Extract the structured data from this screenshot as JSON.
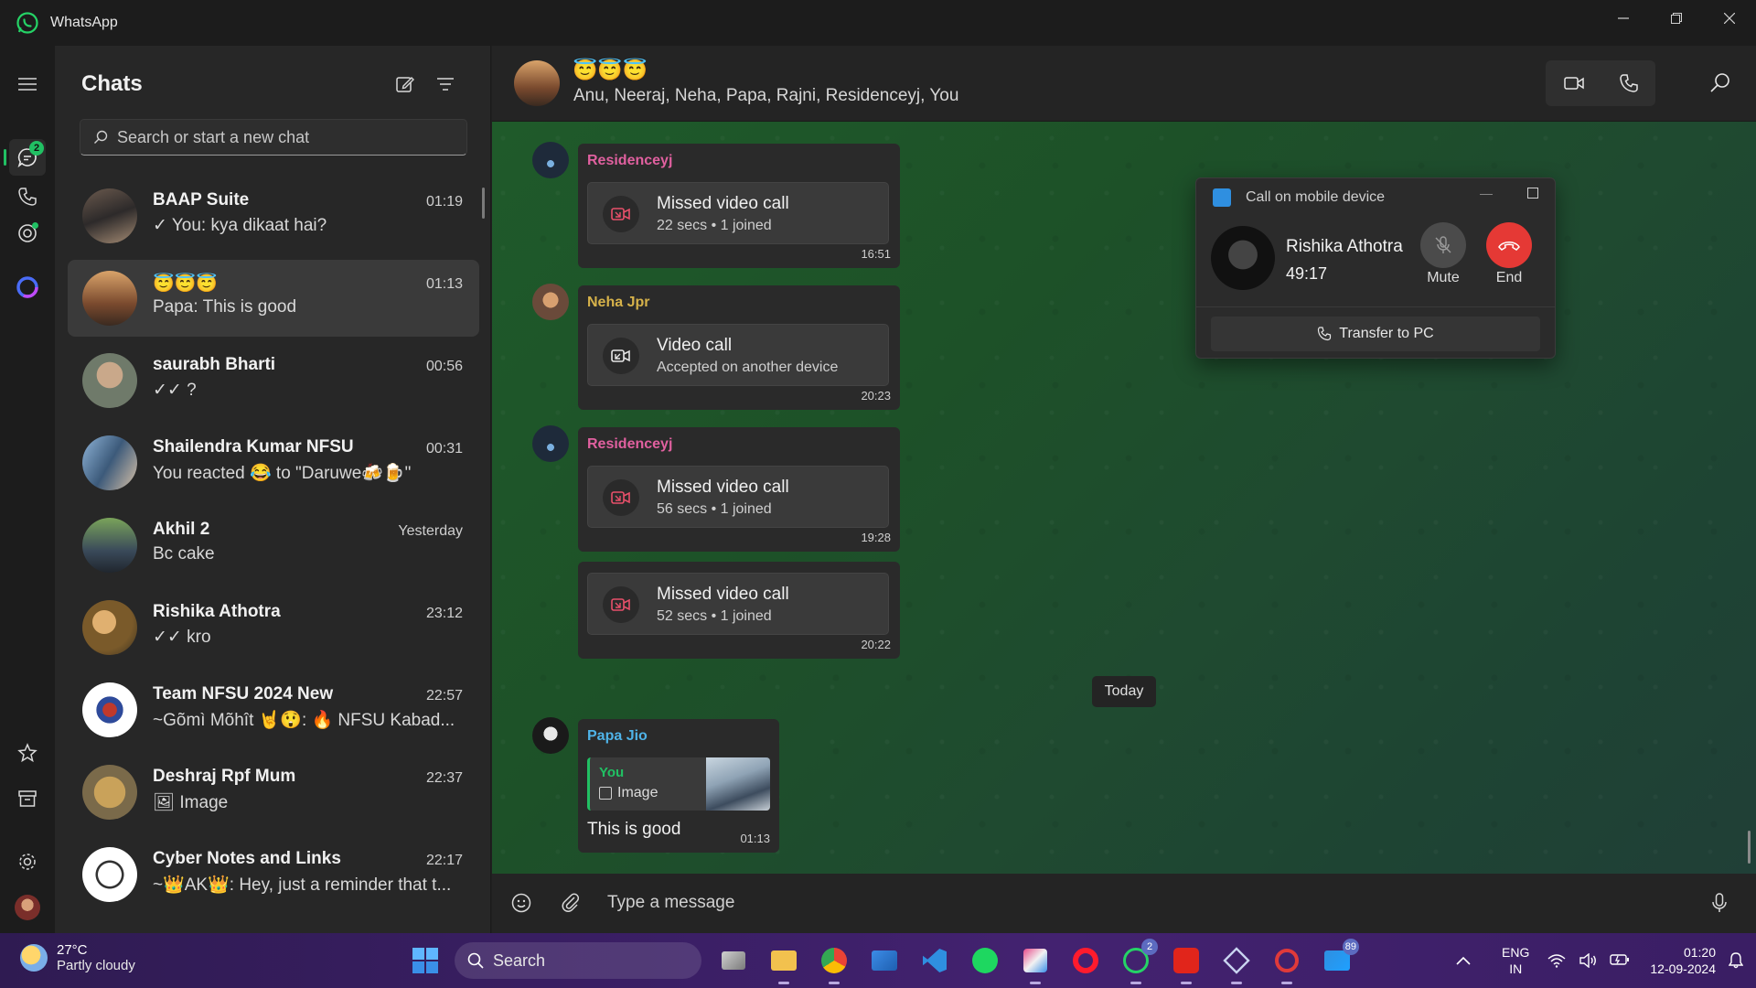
{
  "window": {
    "title": "WhatsApp"
  },
  "rail": {
    "chats_badge": "2"
  },
  "chatlist": {
    "title": "Chats",
    "search_placeholder": "Search or start a new chat",
    "chats": [
      {
        "name": "BAAP Suite",
        "time": "01:19",
        "preview": "✓ You: kya dikaat hai?"
      },
      {
        "name": "😇😇😇",
        "time": "01:13",
        "preview": "Papa: This is good",
        "selected": true
      },
      {
        "name": "saurabh Bharti",
        "time": "00:56",
        "preview": "✓✓ ?"
      },
      {
        "name": "Shailendra Kumar NFSU",
        "time": "00:31",
        "preview": "You reacted 😂 to \"Daruwe🍻🍺\""
      },
      {
        "name": "Akhil 2",
        "time": "Yesterday",
        "preview": "Bc cake"
      },
      {
        "name": "Rishika Athotra",
        "time": "23:12",
        "preview": "✓✓ kro"
      },
      {
        "name": "Team NFSU 2024 New",
        "time": "22:57",
        "preview": "~Gõmì Mõhît 🤘😲: 🔥 NFSU Kabad..."
      },
      {
        "name": "Deshraj Rpf Mum",
        "time": "22:37",
        "preview": "🖼 Image"
      },
      {
        "name": "Cyber Notes and Links",
        "time": "22:17",
        "preview": "~👑AK👑: Hey, just a reminder that t..."
      }
    ]
  },
  "conversation": {
    "title": "😇😇😇",
    "members": "Anu, Neeraj, Neha, Papa, Rajni, Residenceyj, You",
    "messages": [
      {
        "sender": "Residenceyj",
        "card_title": "Missed video call",
        "card_sub": "22 secs • 1 joined",
        "time": "16:51"
      },
      {
        "sender": "Neha Jpr",
        "card_title": "Video call",
        "card_sub": "Accepted on another device",
        "time": "20:23"
      },
      {
        "sender": "Residenceyj",
        "card_title": "Missed video call",
        "card_sub": "56 secs • 1 joined",
        "time": "19:28"
      },
      {
        "card_title": "Missed video call",
        "card_sub": "52 secs • 1 joined",
        "time": "20:22"
      }
    ],
    "date_divider": "Today",
    "last_message": {
      "sender": "Papa Jio",
      "quote_sender": "You",
      "quote_text": "Image",
      "text": "This is good",
      "time": "01:13"
    },
    "composer_placeholder": "Type a message"
  },
  "call_popup": {
    "title": "Call on mobile device",
    "name": "Rishika Athotra",
    "timer": "49:17",
    "mute_label": "Mute",
    "end_label": "End",
    "transfer_label": "Transfer to PC"
  },
  "taskbar": {
    "temperature": "27°C",
    "condition": "Partly cloudy",
    "search_label": "Search",
    "whatsapp_badge": "2",
    "mail_badge": "89",
    "lang_top": "ENG",
    "lang_bottom": "IN",
    "time": "01:20",
    "date": "12-09-2024"
  },
  "colors": {
    "accent_green": "#21c063",
    "residenceyj_name": "#e0609f",
    "neha_name": "#d6b24a",
    "papa_name": "#4fb3e8",
    "missed_call": "#e8506a",
    "end_button": "#e53935"
  }
}
